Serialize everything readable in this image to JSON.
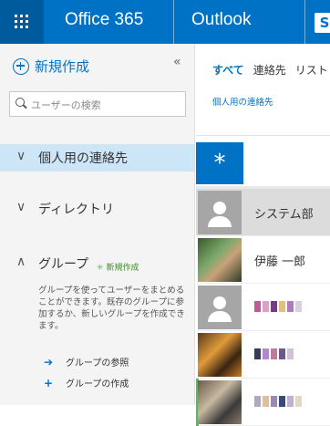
{
  "topbar": {
    "suite": "Office 365",
    "app": "Outlook",
    "bg_color": "#0072c6",
    "waffle_icon": "app-launcher-icon"
  },
  "left_pane": {
    "new_label": "新規作成",
    "collapse_glyph": "«",
    "search_placeholder": "ユーザーの検索",
    "nav": [
      {
        "label": "個人用の連絡先",
        "chevron": "∨"
      },
      {
        "label": "ディレクトリ",
        "chevron": "∨"
      },
      {
        "label": "グループ",
        "chevron": "∧"
      }
    ],
    "groups_new": "新規作成",
    "groups_description": "グループを使ってユーザーをまとめることができます。既存のグループに参加するか、新しいグループを作成できます。",
    "links": [
      {
        "icon": "➔",
        "label": "グループの参照"
      },
      {
        "icon": "+",
        "label": "グループの作成"
      }
    ]
  },
  "right_pane": {
    "filters": [
      "すべて",
      "連絡先",
      "リスト"
    ],
    "breadcrumb": "個人用の連絡先",
    "star_glyph": "*",
    "contacts": [
      {
        "name": "システム部",
        "avatar": "default-person"
      },
      {
        "name": "伊藤 一郎",
        "avatar": "photo"
      }
    ]
  }
}
